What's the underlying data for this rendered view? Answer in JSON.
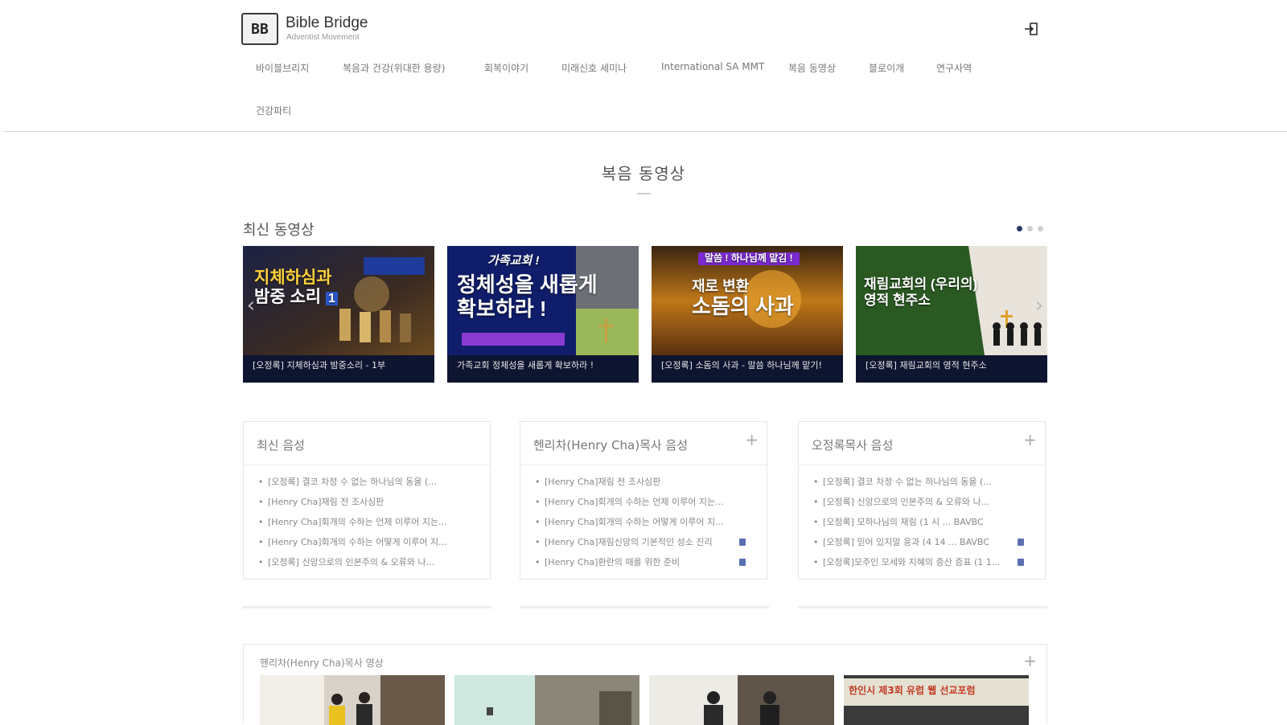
{
  "header": {
    "logo_mark": "BB",
    "logo_title": "Bible Bridge",
    "logo_subtitle": "Adventist Movement"
  },
  "nav": {
    "items": [
      "바이블브리지",
      "복음과 건강(위대한 용량)",
      "회복이야기",
      "미래신호 세미나",
      "International SA MMT",
      "복음 동영상",
      "블로이개",
      "연구사역",
      "건강파티"
    ]
  },
  "page": {
    "title": "복음 동영상"
  },
  "latest_videos": {
    "title": "최신 동영상",
    "cards": [
      {
        "headline_line1": "지체하심과",
        "headline_line2": "밤중 소리",
        "badge": "1",
        "caption": "[오정록] 지체하심과 밤중소리 - 1부"
      },
      {
        "headline_top": "가족교회 !",
        "headline_line1": "정체성을 새롭게",
        "headline_line2": "확보하라 !",
        "caption": "가족교회 정체성을 새롭게 확보하라 !"
      },
      {
        "banner": "말씀 ! 하나님께 맡김 !",
        "headline_line1": "재로 변환",
        "headline_line2": "소돔의 사과",
        "caption": "[오정록] 소돔의 사과 - 말씀 하나님께 맡기!"
      },
      {
        "headline_line1": "재림교회의 (우리의)",
        "headline_line2": "영적 현주소",
        "caption": "[오정록] 재림교회의 영적 현주소"
      }
    ]
  },
  "panels": [
    {
      "title": "최신 음성",
      "items": [
        {
          "text": "[오정록] 결코 차정 수 없는 하나님의 동을 (...",
          "new": false
        },
        {
          "text": "[Henry Cha]재림 전 조사심판",
          "new": false
        },
        {
          "text": "[Henry Cha]회개의 수하는 언제 이루어 지는...",
          "new": false
        },
        {
          "text": "[Henry Cha]회개의 수하는 어떻게 이루어 지...",
          "new": false
        },
        {
          "text": "[오정록] 신앙으로의 인본주의 & 오류와 나...",
          "new": false
        }
      ]
    },
    {
      "title": "헨리차(Henry Cha)목사 음성",
      "items": [
        {
          "text": "[Henry Cha]재림 전 조사심판",
          "new": false
        },
        {
          "text": "[Henry Cha]회개의 수하는 언제 이루어 지는...",
          "new": false
        },
        {
          "text": "[Henry Cha]회개의 수하는 어떻게 이루어 지...",
          "new": false
        },
        {
          "text": "[Henry Cha]재림신앙의 기본적인 성소 진리",
          "new": true
        },
        {
          "text": "[Henry Cha]환란의 때를 위한 준비",
          "new": true
        }
      ]
    },
    {
      "title": "오정록목사 음성",
      "items": [
        {
          "text": "[오정록] 결코 차정 수 없는 하나님의 동을 (...",
          "new": false
        },
        {
          "text": "[오정록] 신앙으로의 인본주의 & 오류와 나...",
          "new": false
        },
        {
          "text": "[오정록] 모하나님의 재림 (1 시 ... BAVBC",
          "new": false
        },
        {
          "text": "[오정록] 믿어 있지말 응과 (4 14 ... BAVBC",
          "new": true
        },
        {
          "text": "[오정록]모주인 모세와 지혜의 증산 증표 (1 1...",
          "new": true
        }
      ]
    }
  ],
  "gallery": {
    "title": "헨리차(Henry Cha)목사 영상",
    "last_photo_text": "한인시 제3회 유럽 웹 선교포럼"
  },
  "colors": {
    "caption_bg": "#0d1530",
    "accent_dot": "#2b3a6b",
    "new_mark": "#5a6fb2"
  }
}
